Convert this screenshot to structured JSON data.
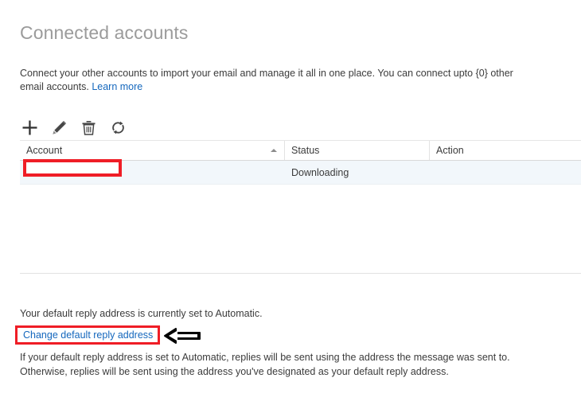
{
  "page": {
    "title": "Connected accounts",
    "intro_text": "Connect your other accounts to import your email and manage it all in one place. You can connect upto {0} other email accounts. ",
    "learn_more_label": "Learn more"
  },
  "toolbar": {
    "items": [
      {
        "name": "add-account-button",
        "icon": "plus-icon",
        "label": "Add"
      },
      {
        "name": "edit-account-button",
        "icon": "pencil-icon",
        "label": "Edit"
      },
      {
        "name": "delete-account-button",
        "icon": "trash-icon",
        "label": "Delete"
      },
      {
        "name": "refresh-accounts-button",
        "icon": "refresh-icon",
        "label": "Refresh"
      }
    ]
  },
  "grid": {
    "columns": [
      {
        "label": "Account",
        "sort": "ascending"
      },
      {
        "label": "Status",
        "sort": "none"
      },
      {
        "label": "Action",
        "sort": "none"
      }
    ],
    "rows": [
      {
        "account": "",
        "status": "Downloading",
        "action": ""
      }
    ],
    "redaction_note": "account value obscured by red redaction box"
  },
  "footer": {
    "reply_status": "Your default reply address is currently set to Automatic.",
    "change_link_label": "Change default reply address",
    "footnote": "If your default reply address is set to Automatic, replies will be sent using the address the message was sent to. Otherwise, replies will be sent using the address you've designated as your default reply address."
  },
  "annotations": {
    "highlight_color": "#ef1d26",
    "arrow_direction": "left",
    "arrow_color": "#000000"
  },
  "colors": {
    "title": "#9b9b9b",
    "link": "#1467bd",
    "text": "#3b3b3b",
    "row_background": "#f2f7fb",
    "grid_line": "#e2e2e2"
  }
}
